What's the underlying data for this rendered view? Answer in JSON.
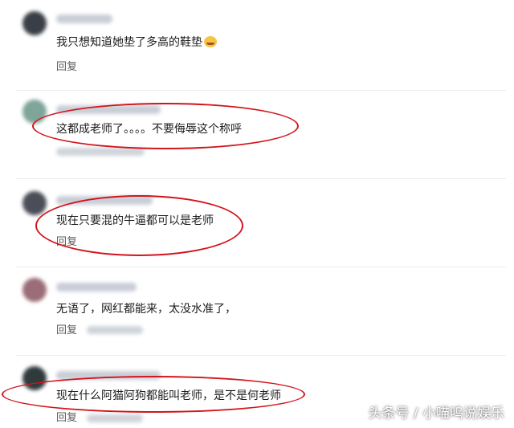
{
  "comments": [
    {
      "text": "我只想知道她垫了多高的鞋垫",
      "emoji": "laughing-crying-emoji",
      "reply_label": "回复"
    },
    {
      "text": "这都成老师了。。。。不要侮辱这个称呼",
      "reply_label": ""
    },
    {
      "text": "现在只要混的牛逼都可以是老师",
      "reply_label": "回复"
    },
    {
      "text": "无语了，网红都能来，太没水准了，",
      "reply_label": "回复"
    },
    {
      "text": "现在什么阿猫阿狗都能叫老师，是不是何老师",
      "reply_label": "回复"
    }
  ],
  "watermark": "头条号 / 小喵呜说娱乐",
  "colors": {
    "highlight_ellipse": "#d3141b",
    "reply_text": "#5b5b5b"
  }
}
